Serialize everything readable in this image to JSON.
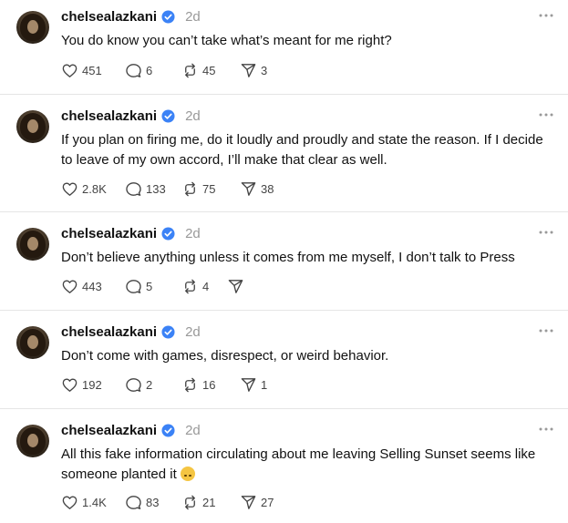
{
  "posts": [
    {
      "username": "chelsealazkani",
      "time": "2d",
      "text": "You do know you can’t take what’s meant for me right?",
      "likes": "451",
      "replies": "6",
      "reposts": "45",
      "shares": "3"
    },
    {
      "username": "chelsealazkani",
      "time": "2d",
      "text": "If you plan on firing me, do it loudly and proudly and state the reason. If I decide to leave of my own accord, I’ll make that clear as well.",
      "likes": "2.8K",
      "replies": "133",
      "reposts": "75",
      "shares": "38"
    },
    {
      "username": "chelsealazkani",
      "time": "2d",
      "text": "Don’t believe anything unless it comes from me myself, I don’t talk to Press",
      "likes": "443",
      "replies": "5",
      "reposts": "4",
      "shares": ""
    },
    {
      "username": "chelsealazkani",
      "time": "2d",
      "text": "Don’t come with games, disrespect, or weird behavior.",
      "likes": "192",
      "replies": "2",
      "reposts": "16",
      "shares": "1"
    },
    {
      "username": "chelsealazkani",
      "time": "2d",
      "text": "All this fake information circulating about me leaving Selling Sunset seems like someone planted it",
      "likes": "1.4K",
      "replies": "83",
      "reposts": "21",
      "shares": "27"
    }
  ],
  "icons": {
    "verified": "verified-badge-icon",
    "more": "more-dots-icon",
    "like": "heart-icon",
    "reply": "comment-icon",
    "repost": "repost-icon",
    "share": "send-icon",
    "emoji": "upside-down-face-emoji"
  },
  "colors": {
    "verified": "#3b82f6",
    "time": "#999999",
    "divider": "#e5e5e5",
    "icon": "#444444"
  }
}
